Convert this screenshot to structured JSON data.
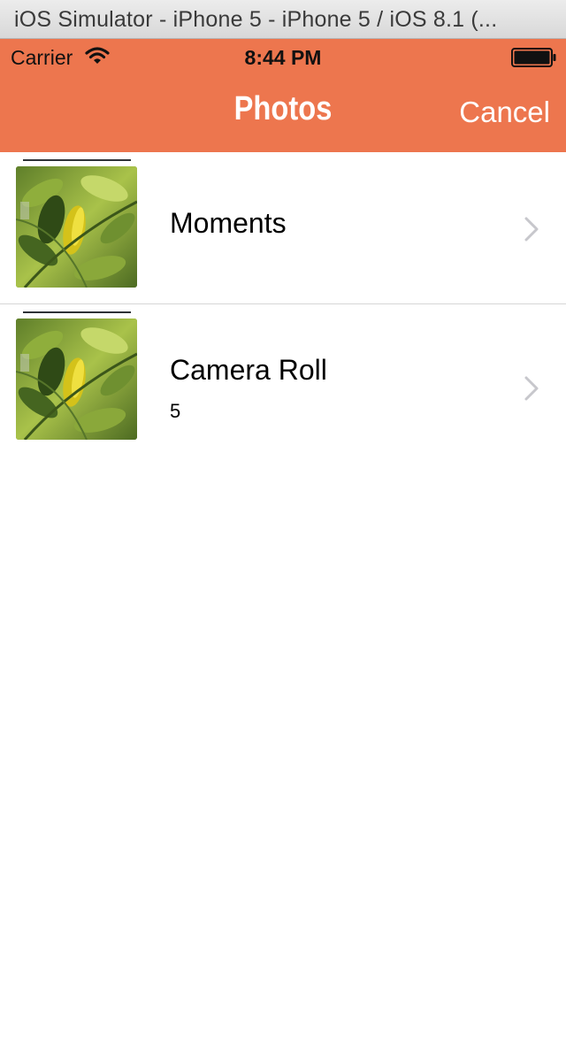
{
  "window": {
    "title": "iOS Simulator - iPhone 5 - iPhone 5 / iOS 8.1 (..."
  },
  "status_bar": {
    "carrier": "Carrier",
    "time": "8:44 PM",
    "icons": [
      "wifi-icon",
      "battery-icon"
    ]
  },
  "nav": {
    "title": "Photos",
    "cancel_label": "Cancel",
    "accent_color": "#ed764e"
  },
  "albums": [
    {
      "name": "Moments",
      "count": "",
      "thumbnail": "leaf-photo"
    },
    {
      "name": "Camera Roll",
      "count": "5",
      "thumbnail": "leaf-photo"
    }
  ]
}
